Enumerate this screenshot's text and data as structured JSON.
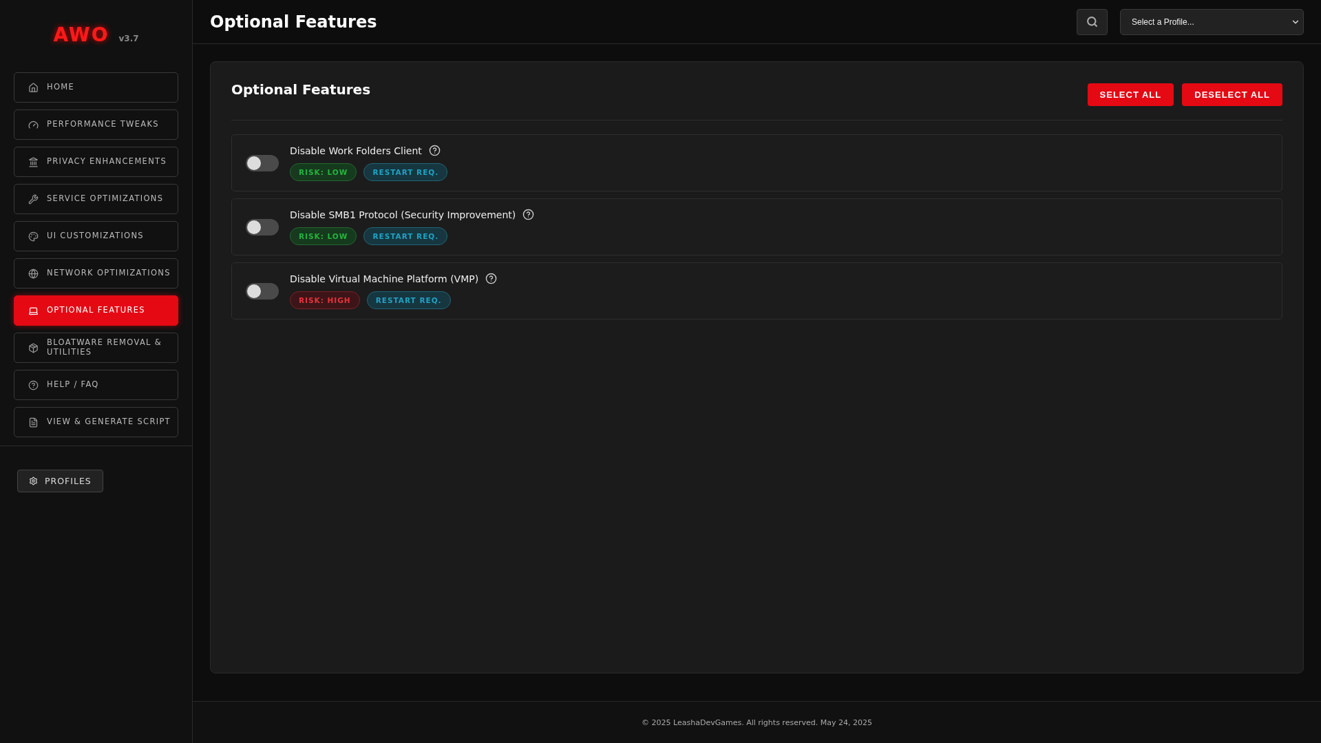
{
  "sidebar": {
    "logo": "AWO",
    "version": "v3.7",
    "items": [
      {
        "label": "HOME",
        "selected": false
      },
      {
        "label": "PERFORMANCE TWEAKS",
        "selected": false
      },
      {
        "label": "PRIVACY ENHANCEMENTS",
        "selected": false
      },
      {
        "label": "SERVICE OPTIMIZATIONS",
        "selected": false
      },
      {
        "label": "UI CUSTOMIZATIONS",
        "selected": false
      },
      {
        "label": "NETWORK OPTIMIZATIONS",
        "selected": false
      },
      {
        "label": "OPTIONAL FEATURES",
        "selected": true
      },
      {
        "label": "BLOATWARE REMOVAL & UTILITIES",
        "selected": false
      },
      {
        "label": "HELP / FAQ",
        "selected": false
      },
      {
        "label": "VIEW & GENERATE SCRIPT",
        "selected": false
      }
    ],
    "profiles_button": "PROFILES"
  },
  "header": {
    "title": "Optional Features",
    "profile_select": "Select a Profile..."
  },
  "panel": {
    "title": "Optional Features",
    "buttons": [
      "SELECT ALL",
      "DESELECT ALL"
    ],
    "features": [
      {
        "name": "Disable Work Folders Client",
        "on": false,
        "tags": [
          {
            "label": "RISK: LOW",
            "kind": "low"
          },
          {
            "label": "RESTART REQ.",
            "kind": "restart"
          }
        ]
      },
      {
        "name": "Disable SMB1 Protocol (Security Improvement)",
        "on": false,
        "tags": [
          {
            "label": "RISK: LOW",
            "kind": "low"
          },
          {
            "label": "RESTART REQ.",
            "kind": "restart"
          }
        ]
      },
      {
        "name": "Disable Virtual Machine Platform (VMP)",
        "on": false,
        "tags": [
          {
            "label": "RISK: HIGH",
            "kind": "high"
          },
          {
            "label": "RESTART REQ.",
            "kind": "restart"
          }
        ]
      }
    ]
  },
  "footer": "© 2025 LeashaDevGames. All rights reserved. May 24, 2025"
}
